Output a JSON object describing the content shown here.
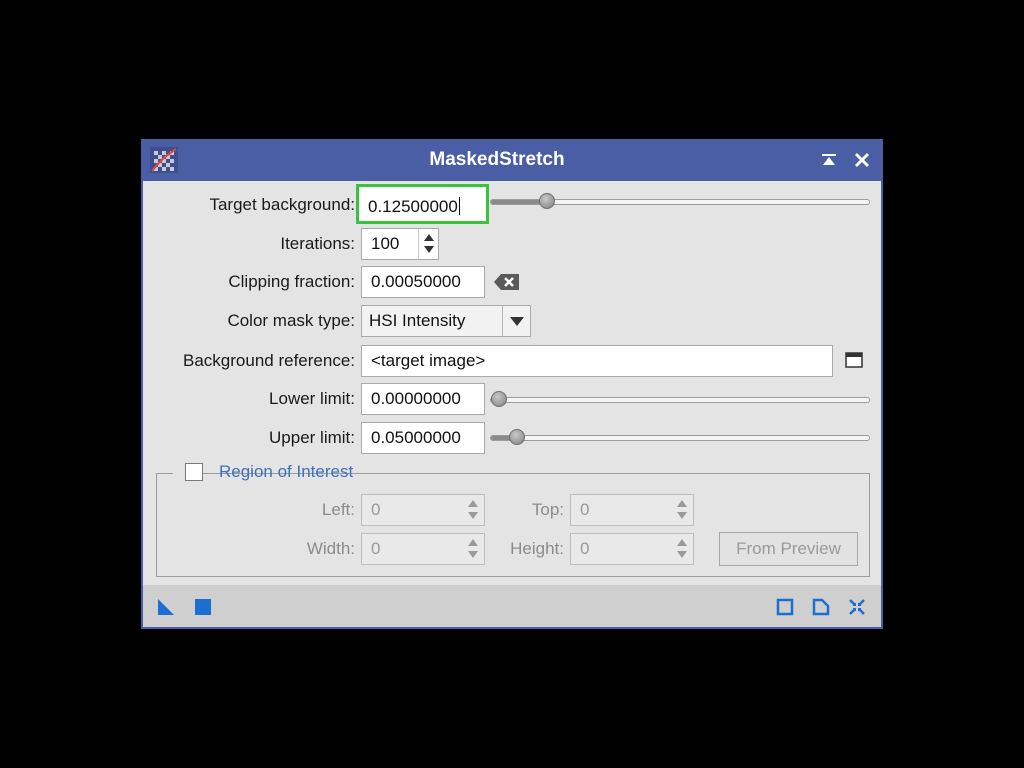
{
  "window": {
    "title": "MaskedStretch",
    "accent_color": "#4a5ea6",
    "title_buttons": [
      "pin-icon",
      "close-icon"
    ]
  },
  "params": {
    "target_background": {
      "label": "Target background:",
      "value": "0.12500000",
      "slider_fraction": 0.125
    },
    "iterations": {
      "label": "Iterations:",
      "value": "100"
    },
    "clipping_fraction": {
      "label": "Clipping fraction:",
      "value": "0.00050000"
    },
    "color_mask_type": {
      "label": "Color mask type:",
      "value": "HSI Intensity"
    },
    "background_reference": {
      "label": "Background reference:",
      "value": "<target image>"
    },
    "lower_limit": {
      "label": "Lower limit:",
      "value": "0.00000000",
      "slider_fraction": 0.0
    },
    "upper_limit": {
      "label": "Upper limit:",
      "value": "0.05000000",
      "slider_fraction": 0.05
    }
  },
  "roi": {
    "title": "Region of Interest",
    "checked": false,
    "left": {
      "label": "Left:",
      "value": "0"
    },
    "top": {
      "label": "Top:",
      "value": "0"
    },
    "width": {
      "label": "Width:",
      "value": "0"
    },
    "height": {
      "label": "Height:",
      "value": "0"
    },
    "from_preview": "From Preview"
  },
  "footer": {
    "left_icons": [
      "new-instance-icon",
      "apply-global-icon"
    ],
    "right_icons": [
      "preview-icon",
      "browse-documentation-icon",
      "reset-icon"
    ],
    "icon_color": "#1a6fd0"
  }
}
